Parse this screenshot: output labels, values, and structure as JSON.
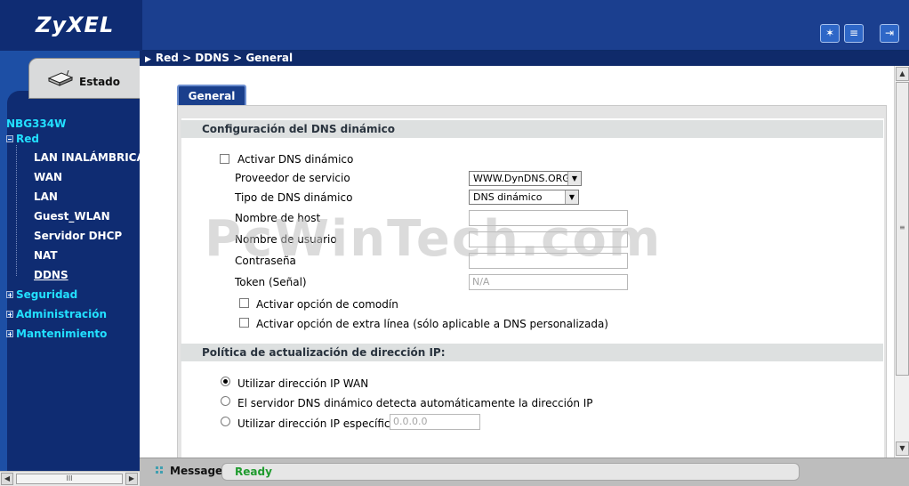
{
  "header": {
    "logo": "ZyXEL",
    "icons": [
      "wizard-icon",
      "notes-icon",
      "logout-icon"
    ]
  },
  "breadcrumb": "Red > DDNS > General",
  "sidebar": {
    "estado_label": "Estado",
    "device_name": "NBG334W",
    "tree": {
      "red_label": "Red",
      "red_items": [
        "LAN INALÁMBRICA",
        "WAN",
        "LAN",
        "Guest_WLAN",
        "Servidor DHCP",
        "NAT",
        "DDNS"
      ],
      "seguridad_label": "Seguridad",
      "administracion_label": "Administración",
      "mantenimiento_label": "Mantenimiento"
    }
  },
  "tab": {
    "label": "General"
  },
  "ddns_section": {
    "title": "Configuración del DNS dinámico",
    "enable_label": "Activar DNS dinámico",
    "enable_checked": false,
    "provider_label": "Proveedor de servicio",
    "provider_value": "WWW.DynDNS.ORG",
    "type_label": "Tipo de DNS dinámico",
    "type_value": "DNS dinámico",
    "hostname_label": "Nombre de host",
    "hostname_value": "",
    "username_label": "Nombre de usuario",
    "username_value": "",
    "password_label": "Contraseña",
    "password_value": "",
    "token_label": "Token (Señal)",
    "token_value": "N/A",
    "wildcard_label": "Activar opción de comodín",
    "wildcard_checked": false,
    "offline_label": "Activar opción de extra línea (sólo aplicable a DNS personalizada)",
    "offline_checked": false
  },
  "ip_policy_section": {
    "title": "Política de actualización de dirección IP:",
    "options": [
      {
        "label": "Utilizar dirección IP WAN",
        "selected": true
      },
      {
        "label": "El servidor DNS dinámico detecta automáticamente la dirección IP",
        "selected": false
      },
      {
        "label": "Utilizar dirección IP específica",
        "selected": false
      }
    ],
    "specific_ip_value": "0.0.0.0"
  },
  "watermark": "PcWinTech.com",
  "statusbar": {
    "label": "Message",
    "value": "Ready"
  },
  "colors": {
    "header_bg": "#1b3f8f",
    "sidebar_bg": "#1d4fa5",
    "tree_category": "#22e0ff",
    "status_ready": "#1f9b2e"
  }
}
